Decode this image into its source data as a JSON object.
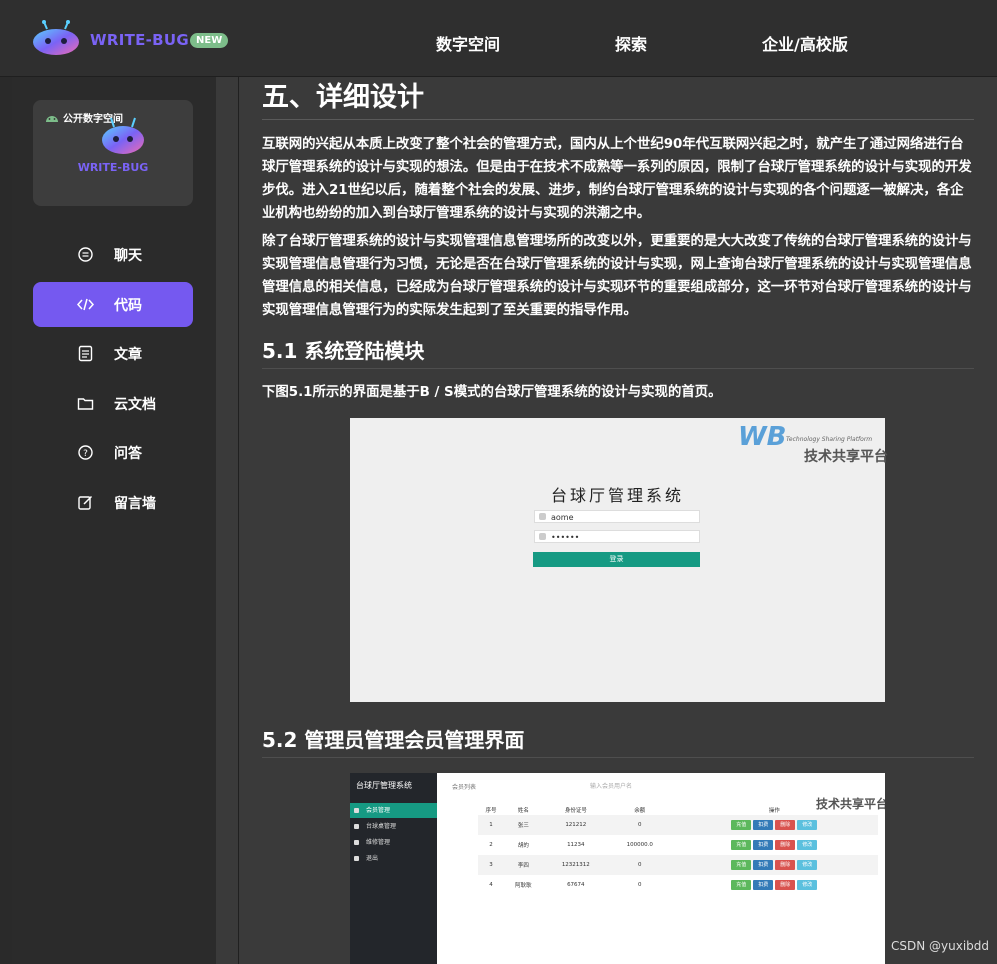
{
  "header": {
    "brand": "WRITE-BUG",
    "badge": "NEW",
    "nav": [
      "数字空间",
      "探索",
      "企业/高校版"
    ]
  },
  "sidebar": {
    "space_tag": "公开数字空间",
    "space_brand": "WRITE-BUG",
    "items": [
      {
        "label": "聊天",
        "icon": "chat-icon"
      },
      {
        "label": "代码",
        "icon": "code-icon",
        "active": true
      },
      {
        "label": "文章",
        "icon": "article-icon"
      },
      {
        "label": "云文档",
        "icon": "folder-icon"
      },
      {
        "label": "问答",
        "icon": "question-icon"
      },
      {
        "label": "留言墙",
        "icon": "edit-icon"
      }
    ]
  },
  "article": {
    "h1": "五、详细设计",
    "p1": "互联网的兴起从本质上改变了整个社会的管理方式，国内从上个世纪90年代互联网兴起之时，就产生了通过网络进行台球厅管理系统的设计与实现的想法。但是由于在技术不成熟等一系列的原因，限制了台球厅管理系统的设计与实现的开发步伐。进入21世纪以后，随着整个社会的发展、进步，制约台球厅管理系统的设计与实现的各个问题逐一被解决，各企业机构也纷纷的加入到台球厅管理系统的设计与实现的洪潮之中。",
    "p2": "除了台球厅管理系统的设计与实现管理信息管理场所的改变以外，更重要的是大大改变了传统的台球厅管理系统的设计与实现管理信息管理行为习惯，无论是否在台球厅管理系统的设计与实现，网上查询台球厅管理系统的设计与实现管理信息管理信息的相关信息，已经成为台球厅管理系统的设计与实现环节的重要组成部分，这一环节对台球厅管理系统的设计与实现管理信息管理行为的实际发生起到了至关重要的指导作用。",
    "h2_1": "5.1 系统登陆模块",
    "p3": "下图5.1所示的界面是基于B / S模式的台球厅管理系统的设计与实现的首页。",
    "h2_2": "5.2 管理员管理会员管理界面"
  },
  "login_shot": {
    "title": "台球厅管理系统",
    "username": "aome",
    "password": "••••••",
    "button": "登录",
    "wm_logo": "WB",
    "wm_sub": "Technology Sharing Platform",
    "wm_cn": "技术共享平台"
  },
  "admin_shot": {
    "title": "台球厅管理系统",
    "menu": [
      "会员管理",
      "台球桌管理",
      "维修管理",
      "退出"
    ],
    "top_label": "会员列表",
    "search_placeholder": "输入会员用户名",
    "headers": [
      "序号",
      "姓名",
      "身份证号",
      "余额",
      "操作"
    ],
    "rows": [
      [
        "1",
        "张三",
        "121212",
        "0"
      ],
      [
        "2",
        "胡的",
        "11234",
        "100000.0"
      ],
      [
        "3",
        "李四",
        "12321312",
        "0"
      ],
      [
        "4",
        "阿耿耿",
        "67674",
        "0"
      ]
    ],
    "action_sets": [
      [
        "充值",
        "扣费",
        "删除",
        "修改"
      ],
      [
        "充值",
        "扣费",
        "删除",
        "修改"
      ],
      [
        "充值",
        "扣费",
        "删除",
        "修改"
      ],
      [
        "充值",
        "扣费",
        "删除",
        "修改"
      ]
    ],
    "wm_cn": "技术共享平台"
  },
  "footer": {
    "mark": "CSDN @yuxibdd"
  },
  "colors": {
    "accent": "#7559f0",
    "green": "#169a83",
    "badge": "#7dbd8a"
  }
}
